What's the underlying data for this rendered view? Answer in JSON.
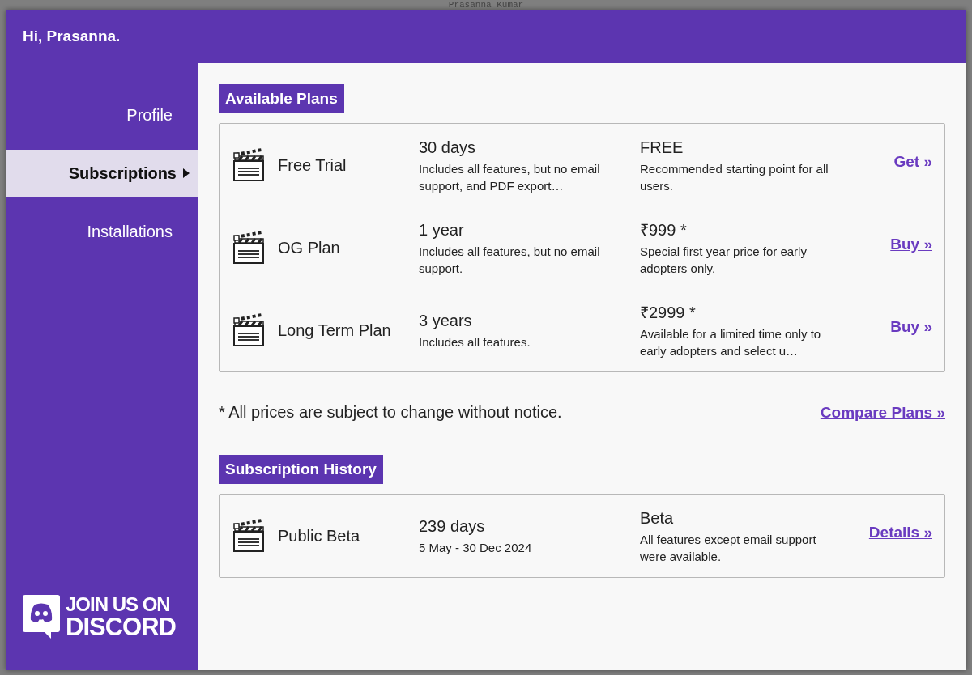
{
  "background": {
    "title": "Prasanna Kumar"
  },
  "header": {
    "greeting": "Hi, Prasanna."
  },
  "sidebar": {
    "items": [
      {
        "label": "Profile",
        "selected": false
      },
      {
        "label": "Subscriptions",
        "selected": true
      },
      {
        "label": "Installations",
        "selected": false
      }
    ],
    "banner": {
      "line_1": "JOIN US ON",
      "line_2": "DISCORD"
    }
  },
  "available_plans": {
    "heading": "Available Plans",
    "plans": [
      {
        "name": "Free Trial",
        "duration": "30 days",
        "duration_note": "Includes all features, but no email support, and PDF export…",
        "price": "FREE",
        "price_note": "Recommended starting point for all users.",
        "action": "Get »"
      },
      {
        "name": "OG Plan",
        "duration": "1 year",
        "duration_note": "Includes all features, but no email support.",
        "price": "₹999 *",
        "price_note": "Special first year price for early adopters only.",
        "action": "Buy »"
      },
      {
        "name": "Long Term Plan",
        "duration": "3 years",
        "duration_note": "Includes all features.",
        "price": "₹2999 *",
        "price_note": "Available for a limited time only to early adopters and select u…",
        "action": "Buy »"
      }
    ],
    "footnote": "* All prices are subject to change without notice.",
    "compare_link": "Compare Plans »"
  },
  "subscription_history": {
    "heading": "Subscription History",
    "entries": [
      {
        "name": "Public Beta",
        "duration": "239 days",
        "duration_note": "5 May - 30 Dec 2024",
        "price": "Beta",
        "price_note": "All features except email support were available.",
        "action": "Details »"
      }
    ]
  }
}
